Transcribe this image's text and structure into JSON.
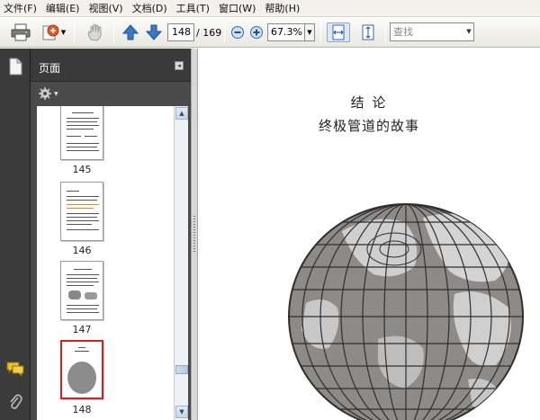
{
  "menu": {
    "items": [
      "文件(F)",
      "编辑(E)",
      "视图(V)",
      "文档(D)",
      "工具(T)",
      "窗口(W)",
      "帮助(H)"
    ]
  },
  "toolbar": {
    "page_current": "148",
    "page_total": "/ 169",
    "zoom_value": "67.3%",
    "search_placeholder": "查找"
  },
  "panel": {
    "title": "页面",
    "thumbnails": [
      {
        "label": "145"
      },
      {
        "label": "146"
      },
      {
        "label": "147"
      },
      {
        "label": "148"
      }
    ]
  },
  "document": {
    "heading": "结      论",
    "subheading": "终极管道的故事"
  },
  "colors": {
    "panel_bg": "#4a4a4a",
    "selection": "#d62020",
    "accent_blue": "#3a78c8"
  },
  "icons": [
    "printer-icon",
    "send-icon",
    "hand-icon",
    "arrow-up-icon",
    "arrow-down-icon",
    "zoom-out-icon",
    "zoom-in-icon",
    "fit-width-icon",
    "fit-page-icon",
    "pages-icon",
    "options-icon",
    "comment-icon",
    "attachment-icon"
  ]
}
